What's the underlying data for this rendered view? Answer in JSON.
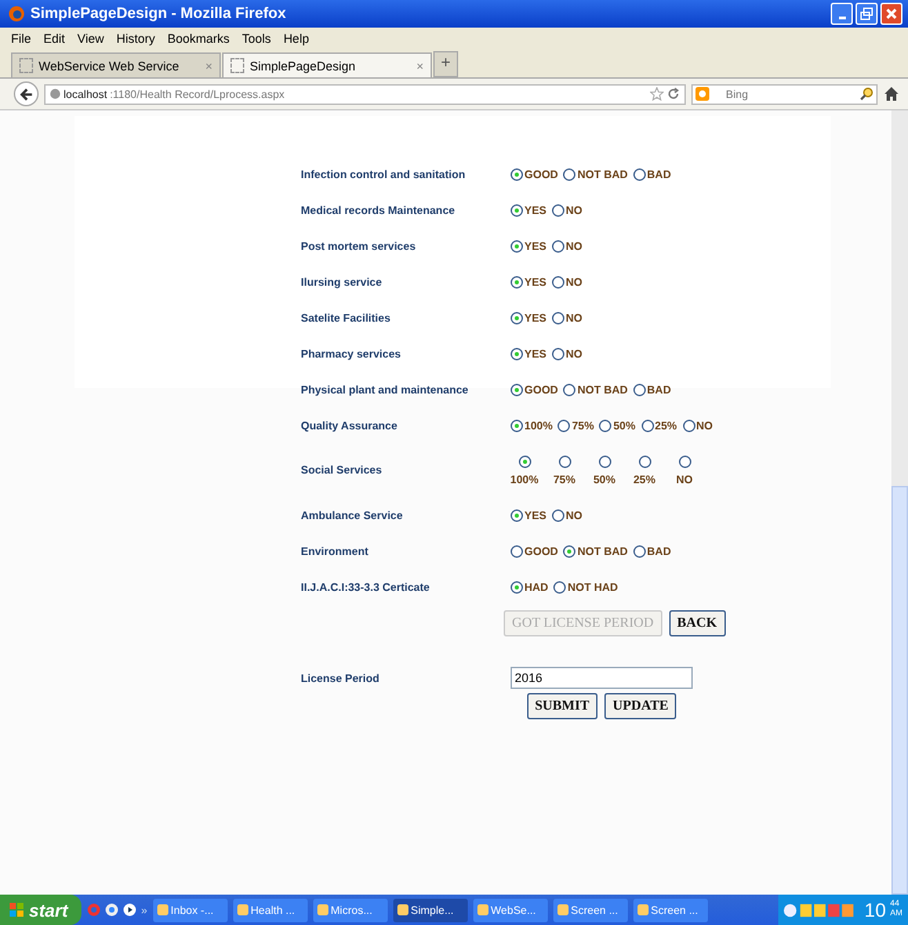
{
  "window": {
    "title": "SimplePageDesign - Mozilla Firefox"
  },
  "menu": [
    "File",
    "Edit",
    "View",
    "History",
    "Bookmarks",
    "Tools",
    "Help"
  ],
  "tabs": [
    {
      "label": "WebService Web Service",
      "selected": false,
      "close": "×"
    },
    {
      "label": "SimplePageDesign",
      "selected": true,
      "close": "×"
    }
  ],
  "new_tab": "+",
  "address": {
    "host": "localhost",
    "path": ":1180/Health Record/Lprocess.aspx"
  },
  "search": {
    "placeholder": "Bing"
  },
  "form": [
    {
      "label": "Infection control and sanitation",
      "kind": "inline",
      "options": [
        {
          "label": "GOOD",
          "selected": true
        },
        {
          "label": "NOT BAD",
          "selected": false
        },
        {
          "label": "BAD",
          "selected": false
        }
      ]
    },
    {
      "label": "Medical records Maintenance",
      "kind": "inline",
      "options": [
        {
          "label": "YES",
          "selected": true
        },
        {
          "label": "NO",
          "selected": false
        }
      ]
    },
    {
      "label": "Post mortem services",
      "kind": "inline",
      "options": [
        {
          "label": "YES",
          "selected": true
        },
        {
          "label": "NO",
          "selected": false
        }
      ]
    },
    {
      "label": "Ilursing service",
      "kind": "inline",
      "options": [
        {
          "label": "YES",
          "selected": true
        },
        {
          "label": "NO",
          "selected": false
        }
      ]
    },
    {
      "label": "Satelite Facilities",
      "kind": "inline",
      "options": [
        {
          "label": "YES",
          "selected": true
        },
        {
          "label": "NO",
          "selected": false
        }
      ]
    },
    {
      "label": "Pharmacy services",
      "kind": "inline",
      "options": [
        {
          "label": "YES",
          "selected": true
        },
        {
          "label": "NO",
          "selected": false
        }
      ]
    },
    {
      "label": "Physical plant and maintenance",
      "kind": "inline",
      "options": [
        {
          "label": "GOOD",
          "selected": true
        },
        {
          "label": "NOT BAD",
          "selected": false
        },
        {
          "label": "BAD",
          "selected": false
        }
      ]
    },
    {
      "label": "Quality Assurance",
      "kind": "inline",
      "options": [
        {
          "label": "100%",
          "selected": true
        },
        {
          "label": "75%",
          "selected": false
        },
        {
          "label": "50%",
          "selected": false
        },
        {
          "label": "25%",
          "selected": false
        },
        {
          "label": "NO",
          "selected": false
        }
      ]
    },
    {
      "label": "Social Services",
      "kind": "stacked",
      "options": [
        {
          "label": "100%",
          "selected": true
        },
        {
          "label": "75%",
          "selected": false
        },
        {
          "label": "50%",
          "selected": false
        },
        {
          "label": "25%",
          "selected": false
        },
        {
          "label": "NO",
          "selected": false
        }
      ]
    },
    {
      "label": "Ambulance Service",
      "kind": "inline",
      "options": [
        {
          "label": "YES",
          "selected": true
        },
        {
          "label": "NO",
          "selected": false
        }
      ]
    },
    {
      "label": "Environment",
      "kind": "inline",
      "options": [
        {
          "label": "GOOD",
          "selected": false
        },
        {
          "label": "NOT BAD",
          "selected": true
        },
        {
          "label": "BAD",
          "selected": false
        }
      ]
    },
    {
      "label": "II.J.A.C.I:33-3.3 Certicate",
      "kind": "inline",
      "options": [
        {
          "label": "HAD",
          "selected": true
        },
        {
          "label": "NOT HAD",
          "selected": false
        }
      ]
    }
  ],
  "actions": [
    {
      "label": "GOT LICENSE PERIOD",
      "disabled": true
    },
    {
      "label": "BACK",
      "disabled": false
    }
  ],
  "license": {
    "label": "License Period",
    "value": "2016"
  },
  "submit_buttons": [
    "SUBMIT",
    "UPDATE"
  ],
  "taskbar": {
    "start": "start",
    "chevron": "»",
    "tasks": [
      {
        "label": "Inbox -...",
        "selected": false
      },
      {
        "label": "Health ...",
        "selected": false
      },
      {
        "label": "Micros...",
        "selected": false
      },
      {
        "label": "Simple...",
        "selected": true
      },
      {
        "label": "WebSe...",
        "selected": false
      },
      {
        "label": "Screen ...",
        "selected": false
      },
      {
        "label": "Screen ...",
        "selected": false
      }
    ],
    "clock": {
      "hour": "10",
      "minute": "44",
      "ampm": "AM"
    }
  }
}
